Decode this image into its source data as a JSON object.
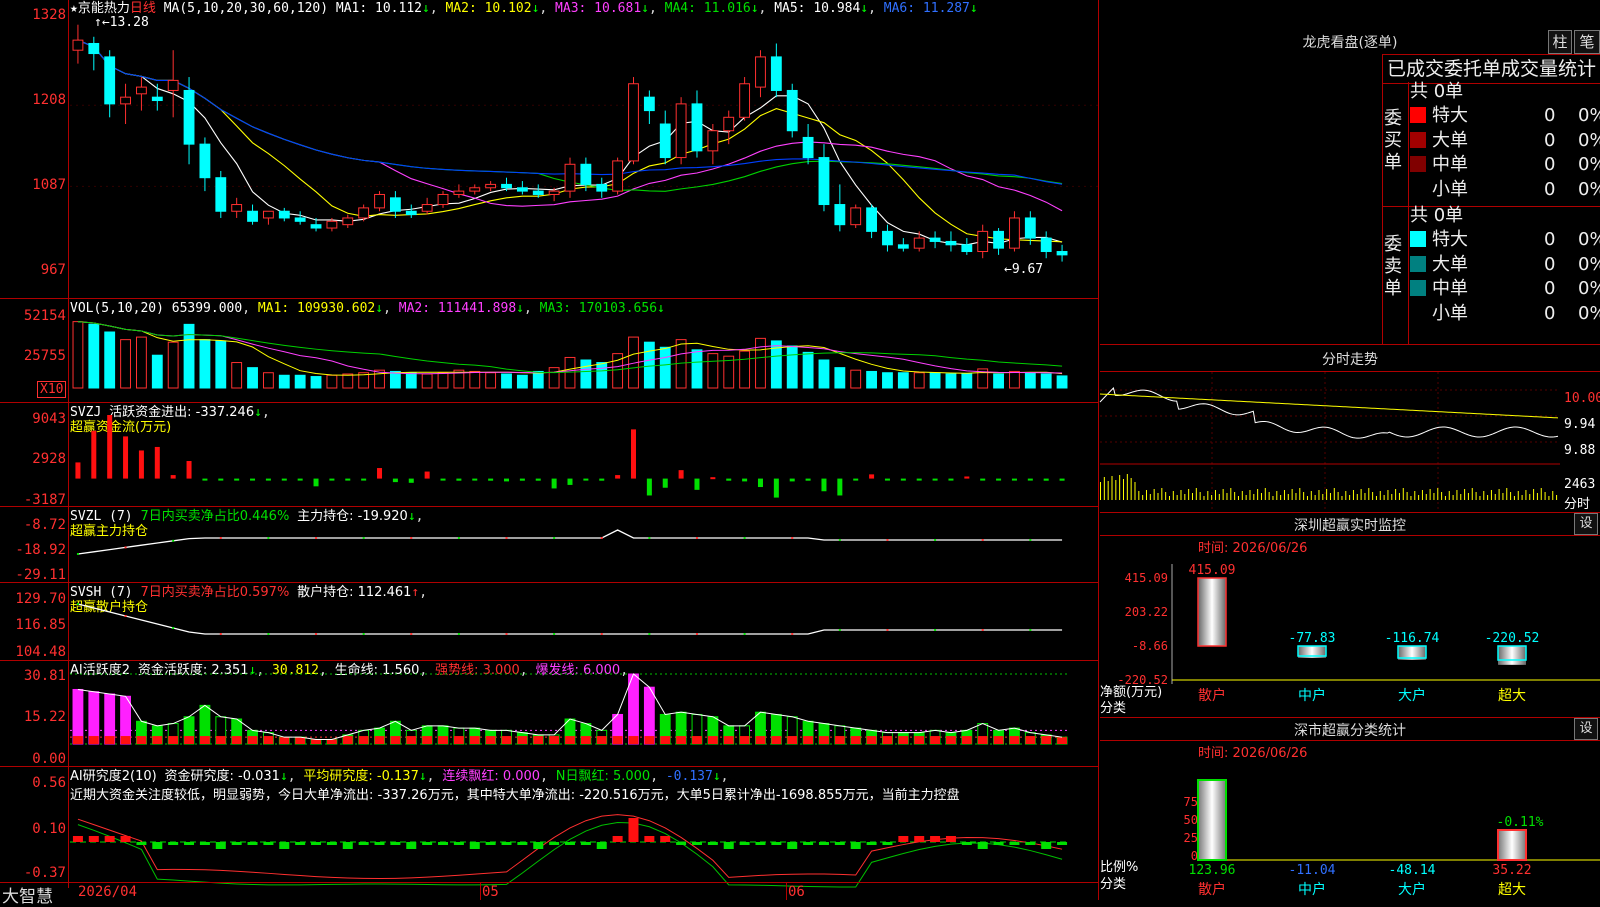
{
  "main_header": {
    "name": "京能热力",
    "period": "日线",
    "ma_params": "MA(5,10,20,30,60,120)",
    "ma1": "MA1: 10.112",
    "ma2": "MA2: 10.102",
    "ma3": "MA3: 10.681",
    "ma4": "MA4: 11.016",
    "ma5": "MA5: 10.984",
    "ma6": "MA6: 11.287",
    "high_mark": "13.28",
    "low_mark": "9.67"
  },
  "price_axis": [
    "1328",
    "1208",
    "1087",
    "967"
  ],
  "vol": {
    "header": "VOL(5,10,20)",
    "val": "65399.000",
    "ma1": "MA1: 109930.602",
    "ma2": "MA2: 111441.898",
    "ma3": "MA3: 170103.656",
    "axis": [
      "52154",
      "25755"
    ],
    "unit": "X10"
  },
  "svzj": {
    "header": "SVZJ",
    "label": "活跃资金进出: -337.246",
    "sub": "超赢资金流(万元)",
    "axis": [
      "9043",
      "2928",
      "-3187"
    ]
  },
  "svzl": {
    "header": "SVZL (7)",
    "label1": "7日内买卖净占比0.446%",
    "label2": "主力持仓: -19.920",
    "sub": "超赢主力持仓",
    "axis": [
      "-8.72",
      "-18.92",
      "-29.11"
    ]
  },
  "svsh": {
    "header": "SVSH (7)",
    "label1": "7日内买卖净占比0.597%",
    "label2": "散户持仓: 112.461",
    "sub": "超赢散户持仓",
    "axis": [
      "129.70",
      "116.85",
      "104.48"
    ]
  },
  "ai1": {
    "header": "AI活跃度2",
    "l1": "资金活跃度: 2.351",
    "l2": "30.812",
    "l3": "生命线: 1.560",
    "l4": "强势线: 3.000",
    "l5": "爆发线: 6.000",
    "axis": [
      "30.81",
      "15.22",
      "0.00"
    ]
  },
  "ai2": {
    "header": "AI研究度2(10)",
    "l1": "资金研究度: -0.031",
    "l2": "平均研究度: -0.137",
    "l3": "连续飘红: 0.000",
    "l4": "N日飘红: 5.000",
    "l5": "-0.137",
    "desc": "近期大资金关注度较低，明显弱势，今日大单净流出: -337.26万元，其中特大单净流出: -220.516万元，大单5日累计净出-1698.855万元，当前主力控盘",
    "axis": [
      "0.56",
      "0.10",
      "-0.37"
    ]
  },
  "date_axis": {
    "d1": "2026/04",
    "d2": "05",
    "d3": "06"
  },
  "brand": "大智慧",
  "chart_data": [
    {
      "type": "candlestick",
      "title": "京能热力 日线",
      "ylim": [
        9.67,
        13.28
      ],
      "candles": [
        [
          12.9,
          13.28,
          12.7,
          13.05
        ],
        [
          13.0,
          13.1,
          12.6,
          12.85
        ],
        [
          12.8,
          12.9,
          11.9,
          12.1
        ],
        [
          12.1,
          12.4,
          11.8,
          12.2
        ],
        [
          12.25,
          12.5,
          12.0,
          12.35
        ],
        [
          12.2,
          12.4,
          12.0,
          12.15
        ],
        [
          12.3,
          12.9,
          11.9,
          12.45
        ],
        [
          12.3,
          12.5,
          11.2,
          11.5
        ],
        [
          11.5,
          11.6,
          10.8,
          11.0
        ],
        [
          11.0,
          11.1,
          10.4,
          10.5
        ],
        [
          10.5,
          10.7,
          10.4,
          10.6
        ],
        [
          10.5,
          10.6,
          10.3,
          10.35
        ],
        [
          10.4,
          10.5,
          10.3,
          10.5
        ],
        [
          10.5,
          10.55,
          10.35,
          10.4
        ],
        [
          10.4,
          10.5,
          10.3,
          10.35
        ],
        [
          10.3,
          10.4,
          10.2,
          10.25
        ],
        [
          10.25,
          10.4,
          10.2,
          10.35
        ],
        [
          10.3,
          10.45,
          10.25,
          10.4
        ],
        [
          10.4,
          10.6,
          10.35,
          10.55
        ],
        [
          10.55,
          10.8,
          10.5,
          10.75
        ],
        [
          10.7,
          10.8,
          10.4,
          10.5
        ],
        [
          10.5,
          10.6,
          10.4,
          10.45
        ],
        [
          10.5,
          10.7,
          10.45,
          10.6
        ],
        [
          10.6,
          10.8,
          10.55,
          10.75
        ],
        [
          10.75,
          10.9,
          10.7,
          10.8
        ],
        [
          10.8,
          10.9,
          10.75,
          10.85
        ],
        [
          10.85,
          10.95,
          10.8,
          10.9
        ],
        [
          10.9,
          11.0,
          10.8,
          10.85
        ],
        [
          10.85,
          10.95,
          10.75,
          10.8
        ],
        [
          10.8,
          10.9,
          10.7,
          10.75
        ],
        [
          10.75,
          10.85,
          10.65,
          10.8
        ],
        [
          10.8,
          11.3,
          10.7,
          11.2
        ],
        [
          11.2,
          11.3,
          10.8,
          10.9
        ],
        [
          10.9,
          11.0,
          10.7,
          10.8
        ],
        [
          10.8,
          11.3,
          10.75,
          11.25
        ],
        [
          11.25,
          12.5,
          11.2,
          12.4
        ],
        [
          12.2,
          12.3,
          11.8,
          12.0
        ],
        [
          11.8,
          12.0,
          11.2,
          11.3
        ],
        [
          11.3,
          12.2,
          11.2,
          12.1
        ],
        [
          12.1,
          12.3,
          11.3,
          11.4
        ],
        [
          11.4,
          11.8,
          11.2,
          11.7
        ],
        [
          11.7,
          12.0,
          11.5,
          11.9
        ],
        [
          11.9,
          12.5,
          11.85,
          12.4
        ],
        [
          12.35,
          12.9,
          12.2,
          12.8
        ],
        [
          12.8,
          13.0,
          12.2,
          12.3
        ],
        [
          12.3,
          12.4,
          11.6,
          11.7
        ],
        [
          11.6,
          11.8,
          11.2,
          11.3
        ],
        [
          11.3,
          11.5,
          10.5,
          10.6
        ],
        [
          10.6,
          10.9,
          10.2,
          10.3
        ],
        [
          10.3,
          10.6,
          10.25,
          10.55
        ],
        [
          10.55,
          10.6,
          10.1,
          10.2
        ],
        [
          10.2,
          10.3,
          9.9,
          10.0
        ],
        [
          10.0,
          10.1,
          9.9,
          9.95
        ],
        [
          9.95,
          10.2,
          9.9,
          10.1
        ],
        [
          10.1,
          10.2,
          9.95,
          10.05
        ],
        [
          10.05,
          10.2,
          9.9,
          10.0
        ],
        [
          10.0,
          10.1,
          9.85,
          9.9
        ],
        [
          9.9,
          10.3,
          9.8,
          10.2
        ],
        [
          10.2,
          10.25,
          9.85,
          9.95
        ],
        [
          9.95,
          10.5,
          9.9,
          10.4
        ],
        [
          10.4,
          10.5,
          10.0,
          10.1
        ],
        [
          10.1,
          10.2,
          9.8,
          9.9
        ],
        [
          9.9,
          10.0,
          9.75,
          9.85
        ]
      ]
    },
    {
      "type": "bar",
      "title": "VOL(5,10,20)",
      "unit": "X10",
      "values": [
        52154,
        50000,
        44000,
        38000,
        40000,
        25755,
        36000,
        50000,
        38000,
        37000,
        20000,
        16000,
        12000,
        10000,
        10000,
        9000,
        10000,
        11000,
        12000,
        14000,
        13000,
        12000,
        11000,
        12000,
        14000,
        13000,
        12000,
        11000,
        10000,
        13000,
        16000,
        24000,
        22000,
        20000,
        27000,
        40000,
        36000,
        32000,
        38000,
        30000,
        27000,
        25000,
        29000,
        39000,
        37000,
        33000,
        28000,
        22000,
        16000,
        14000,
        13000,
        12000,
        12000,
        12000,
        12000,
        11000,
        11000,
        15000,
        11000,
        13000,
        12000,
        11000,
        9500
      ]
    },
    {
      "type": "bar",
      "title": "超赢资金流(万元)",
      "ylim": [
        -3187,
        9043
      ],
      "values": [
        2300,
        6800,
        9043,
        6000,
        4000,
        4500,
        500,
        2500,
        -100,
        -100,
        -100,
        -100,
        -200,
        -100,
        -200,
        -1100,
        -200,
        -100,
        -100,
        1500,
        -500,
        -600,
        1000,
        -200,
        -300,
        -200,
        -300,
        -400,
        -300,
        -300,
        -1400,
        -900,
        -200,
        -300,
        500,
        7000,
        -2400,
        -1300,
        1200,
        -1600,
        200,
        -300,
        -400,
        -1200,
        -2700,
        -400,
        -300,
        -1800,
        -2400,
        -200,
        600,
        -200,
        -200,
        -200,
        -100,
        -200,
        300,
        -200,
        -200,
        -200,
        -200,
        -300,
        -300
      ]
    },
    {
      "type": "line",
      "title": "超赢主力持仓",
      "ylim": [
        -29.11,
        -8.72
      ]
    },
    {
      "type": "line",
      "title": "超赢散户持仓",
      "ylim": [
        104.48,
        129.7
      ]
    },
    {
      "type": "bar",
      "title": "AI活跃度2",
      "ylim": [
        0,
        30.81
      ],
      "values": [
        24,
        23,
        22,
        21,
        10,
        8,
        9,
        12,
        17,
        12,
        11,
        6,
        5,
        3,
        3,
        2,
        2,
        4,
        6,
        7,
        10,
        6,
        8,
        8,
        7,
        7,
        6,
        6,
        5,
        4,
        4,
        11,
        9,
        6,
        13,
        30.81,
        25,
        13,
        14,
        13,
        12,
        8,
        8,
        14,
        13,
        12,
        10,
        9,
        8,
        7,
        6,
        5,
        5,
        5,
        6,
        5,
        6,
        9,
        6,
        7,
        5,
        4,
        3
      ]
    },
    {
      "type": "line",
      "title": "AI研究度2(10)",
      "ylim": [
        -0.37,
        0.56
      ]
    },
    {
      "type": "bar",
      "title": "深圳超赢实时监控",
      "xlabel": "分类",
      "ylabel": "净额(万元)",
      "categories": [
        "散户",
        "中户",
        "大户",
        "超大"
      ],
      "values": [
        415.09,
        -77.83,
        -116.74,
        -220.52
      ],
      "ylim": [
        -220.52,
        415.09
      ]
    },
    {
      "type": "bar",
      "title": "深市超赢分类统计",
      "xlabel": "分类",
      "ylabel": "比例%",
      "categories": [
        "散户",
        "中户",
        "大户",
        "超大"
      ],
      "values": [
        123.96,
        -11.04,
        -48.14,
        35.22
      ],
      "ylim": [
        0,
        75
      ]
    }
  ],
  "right": {
    "dragon_title": "龙虎看盘(逐单)",
    "btn1": "柱",
    "btn2": "笔",
    "stat_title": "已成交委托单成交量统计",
    "buy_label": "委买单",
    "sell_label": "委卖单",
    "buy_total": "共 0单",
    "sell_total": "共 0单",
    "buy_rows": [
      {
        "name": "特大",
        "n": "0",
        "p": "0%",
        "color": "#ff0000"
      },
      {
        "name": "大单",
        "n": "0",
        "p": "0%",
        "color": "#a00000"
      },
      {
        "name": "中单",
        "n": "0",
        "p": "0%",
        "color": "#800000"
      },
      {
        "name": "小单",
        "n": "0",
        "p": "0%",
        "color": "#000000"
      }
    ],
    "sell_rows": [
      {
        "name": "特大",
        "n": "0",
        "p": "0%",
        "color": "#00ffff"
      },
      {
        "name": "大单",
        "n": "0",
        "p": "0%",
        "color": "#008080"
      },
      {
        "name": "中单",
        "n": "0",
        "p": "0%",
        "color": "#008080"
      },
      {
        "name": "小单",
        "n": "0",
        "p": "0%",
        "color": "#000000"
      }
    ],
    "intraday_title": "分时走势",
    "intraday_axis": [
      "10.00",
      "9.94",
      "9.88"
    ],
    "intraday_vol": "2463",
    "intraday_unit": "分时",
    "monitor_title": "深圳超赢实时监控",
    "monitor_set": "设",
    "monitor_time": "时间: 2026/06/26",
    "monitor_vals": [
      "415.09",
      "-77.83",
      "-116.74",
      "-220.52"
    ],
    "monitor_axis": [
      "415.09",
      "203.22",
      "-8.66",
      "-220.52"
    ],
    "monitor_ylabel": "净额(万元)",
    "monitor_xlabel": "分类",
    "cats": [
      "散户",
      "中户",
      "大户",
      "超大"
    ],
    "class_title": "深市超赢分类统计",
    "class_set": "设",
    "class_time": "时间: 2026/06/26",
    "class_vals": [
      "123.96",
      "-11.04",
      "-48.14",
      "35.22"
    ],
    "class_top": "-0.11%",
    "class_axis": [
      "75",
      "50",
      "25",
      "0"
    ],
    "class_ylabel": "比例%",
    "class_xlabel": "分类"
  }
}
